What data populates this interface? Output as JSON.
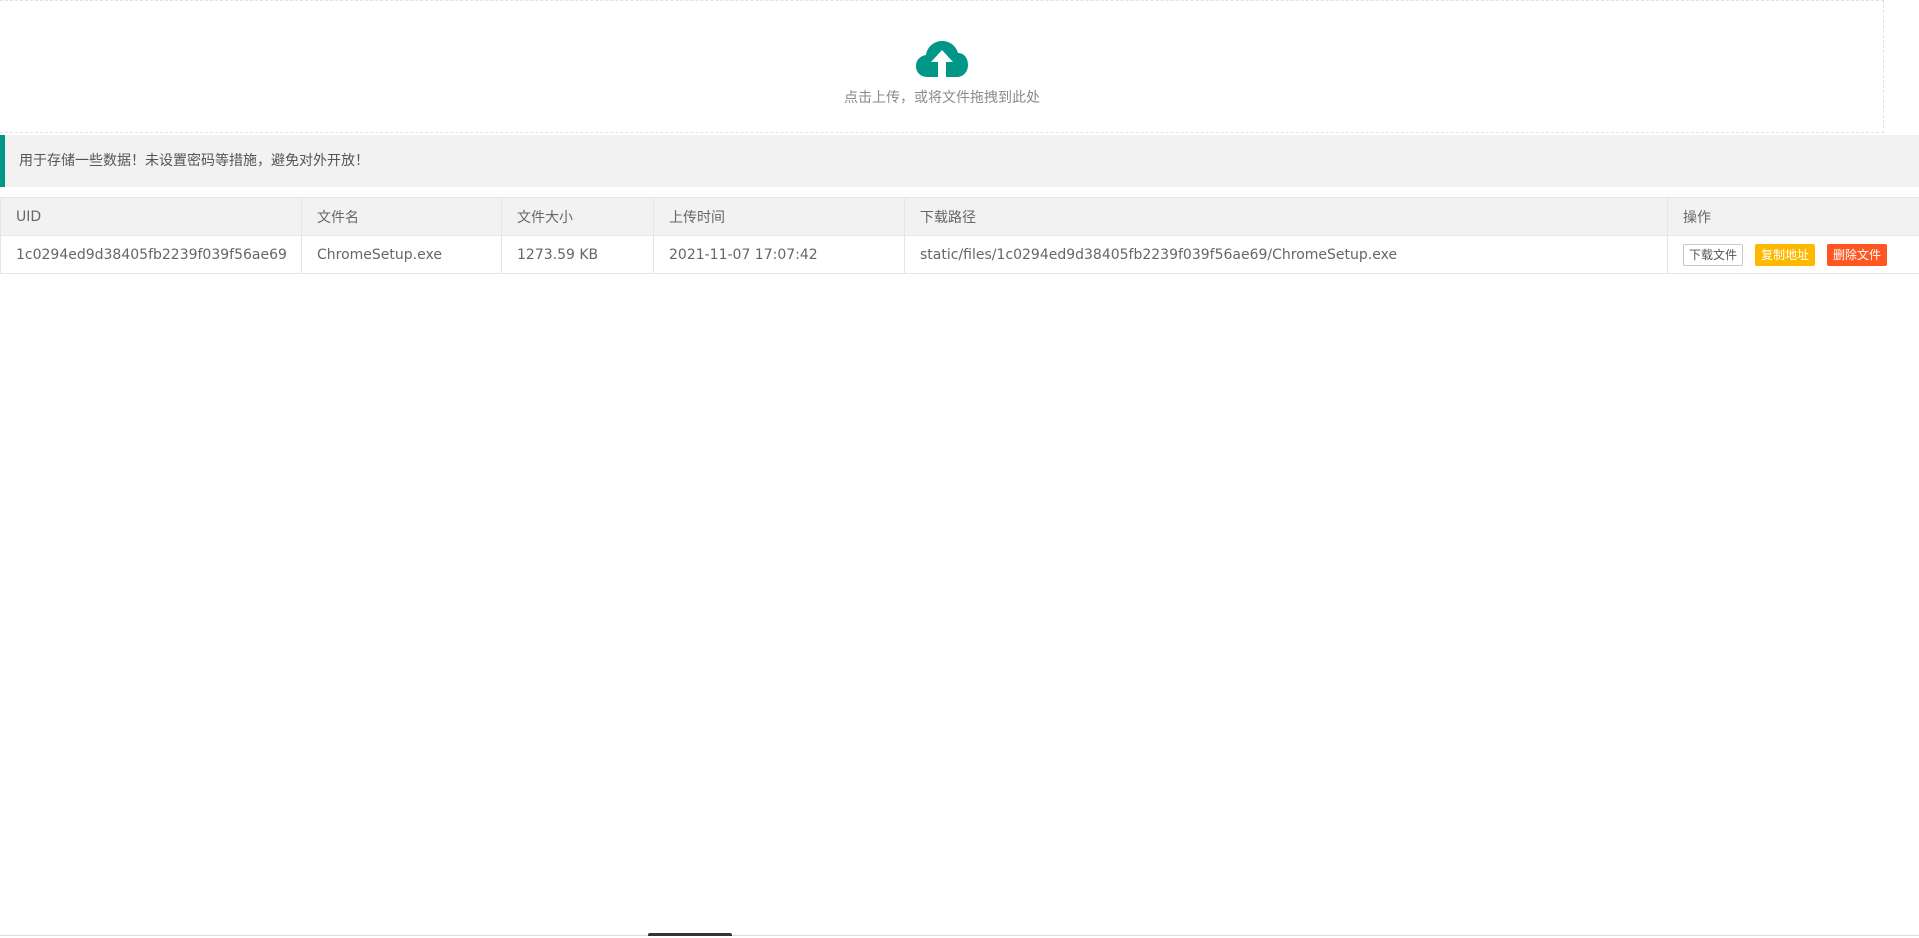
{
  "upload": {
    "icon": "cloud-upload-icon",
    "hint": "点击上传，或将文件拖拽到此处"
  },
  "notice": {
    "text": "用于存储一些数据！未设置密码等措施，避免对外开放！"
  },
  "table": {
    "headers": [
      "UID",
      "文件名",
      "文件大小",
      "上传时间",
      "下载路径",
      "操作"
    ],
    "rows": [
      {
        "uid": "1c0294ed9d38405fb2239f039f56ae69",
        "filename": "ChromeSetup.exe",
        "size": "1273.59 KB",
        "uploaded": "2021-11-07 17:07:42",
        "path": "static/files/1c0294ed9d38405fb2239f039f56ae69/ChromeSetup.exe",
        "actions": {
          "download": "下载文件",
          "copy": "复制地址",
          "delete": "删除文件"
        }
      }
    ]
  },
  "colors": {
    "accent": "#009688",
    "warm": "#FFB800",
    "danger": "#FF5722",
    "header_bg": "#F2F2F2"
  }
}
